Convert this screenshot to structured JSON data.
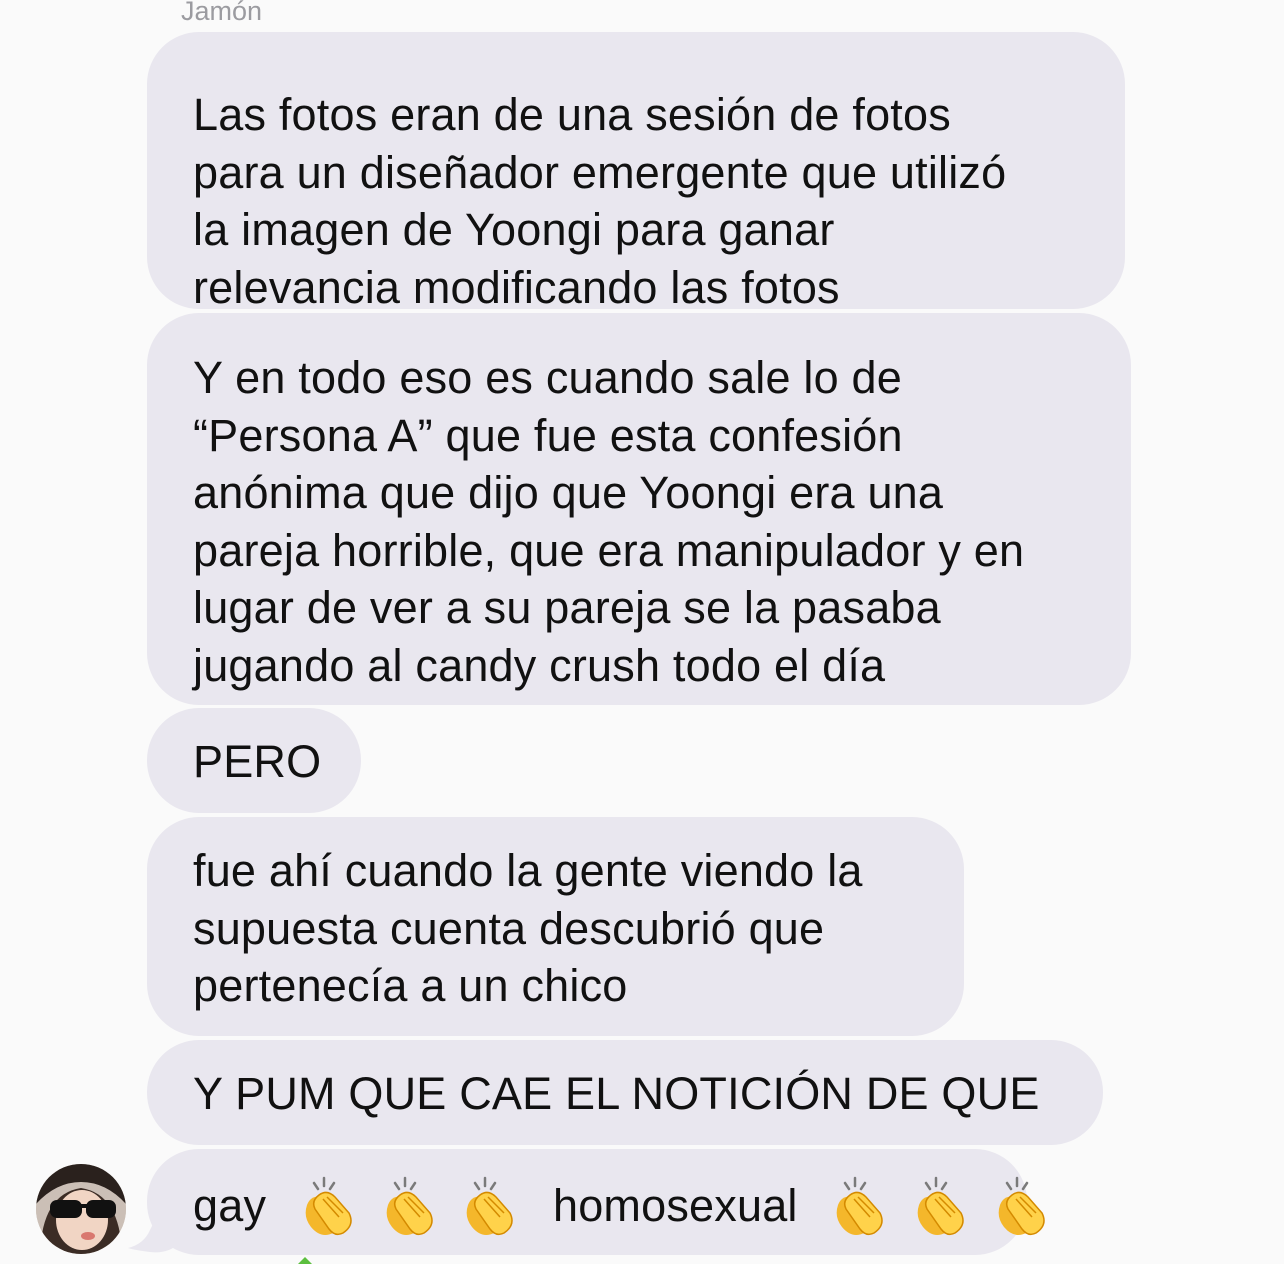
{
  "sender": {
    "name": "Jamón"
  },
  "messages": [
    {
      "lines": [
        "Las fotos eran de una sesión de fotos",
        "para un diseñador emergente que utilizó",
        "la imagen de Yoongi para ganar",
        "relevancia modificando las fotos"
      ]
    },
    {
      "lines": [
        "Y en todo eso es cuando sale lo de",
        "“Persona A” que fue esta confesión",
        "anónima que dijo que Yoongi era una",
        "pareja horrible, que era manipulador y en",
        "lugar de ver a su pareja se la pasaba",
        "jugando al candy crush todo el día"
      ]
    },
    {
      "lines": [
        "PERO"
      ]
    },
    {
      "lines": [
        "fue ahí cuando la gente viendo la",
        "supuesta cuenta descubrió que",
        "pertenecía a un chico"
      ]
    },
    {
      "lines": [
        "Y PUM QUE CAE EL NOTICIÓN DE QUE"
      ]
    },
    {
      "word_1": "gay",
      "word_2": "homosexual",
      "emoji_icon": "clapping-hands-icon"
    }
  ],
  "colors": {
    "bubble": "#e9e7ef",
    "background": "#fafafa",
    "sender_name": "#9b9ba0"
  }
}
